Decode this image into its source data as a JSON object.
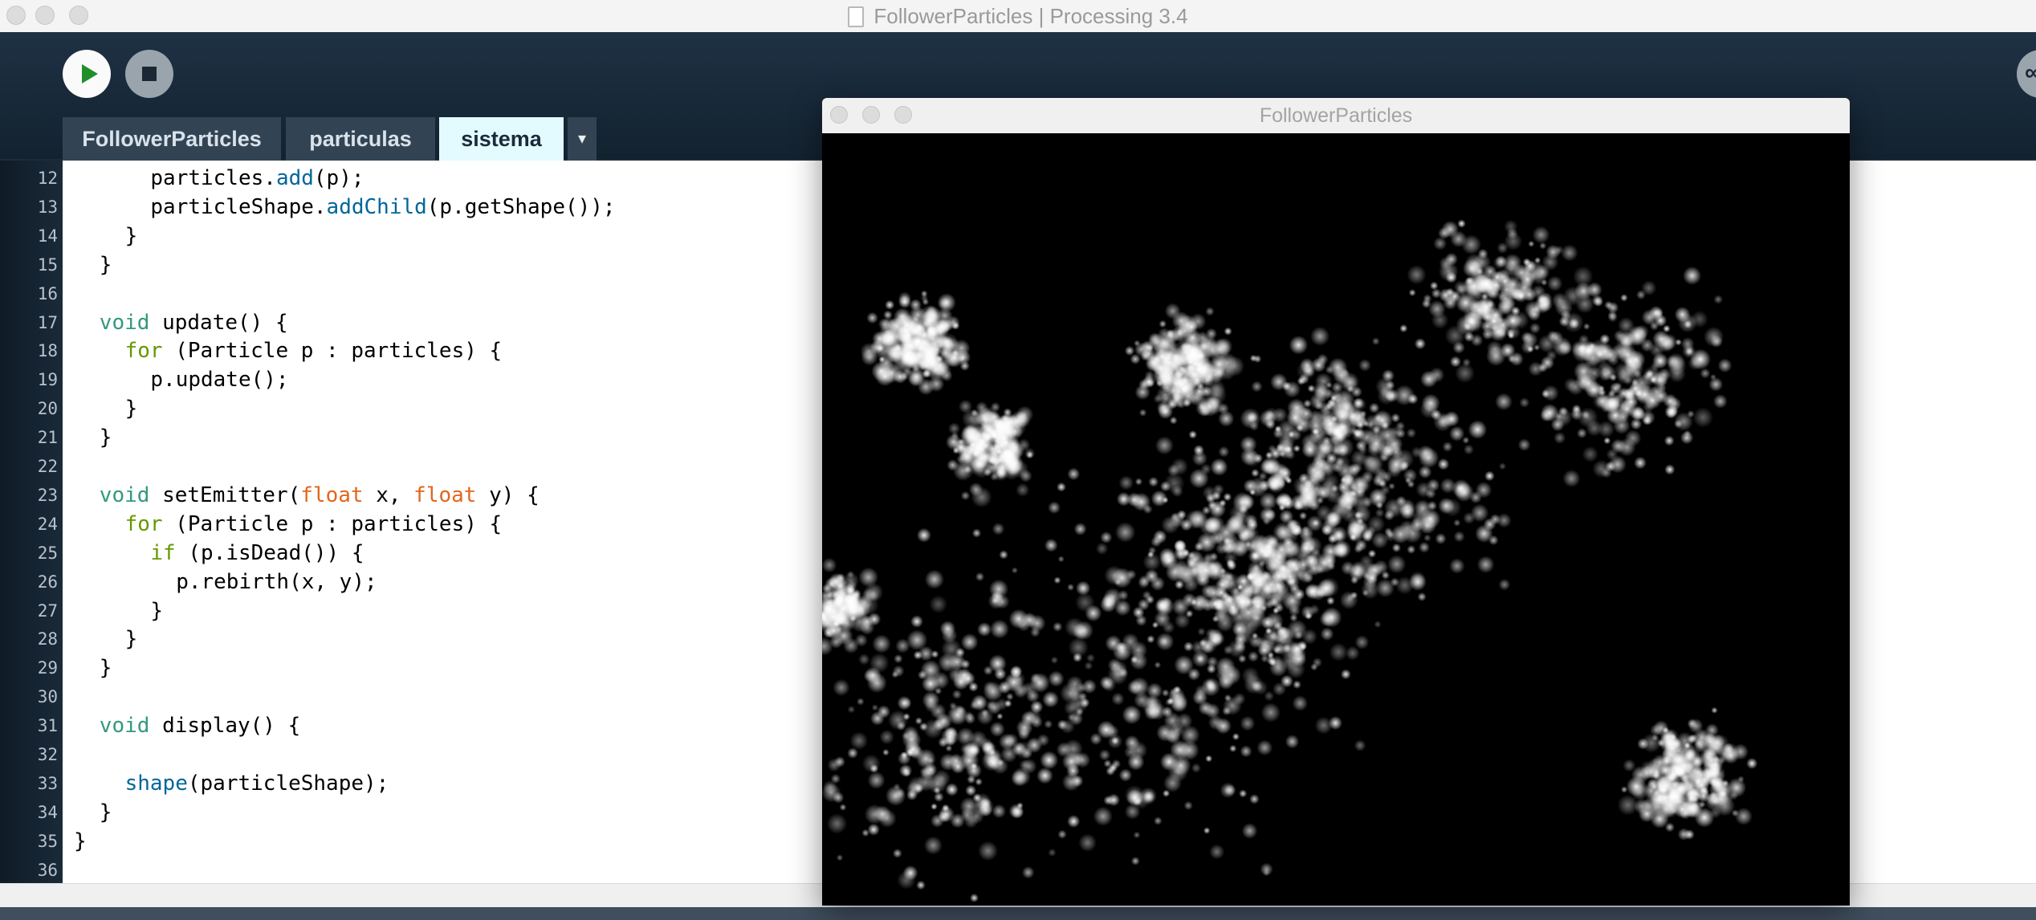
{
  "window": {
    "title": "FollowerParticles | Processing 3.4"
  },
  "toolbar": {
    "run_label": "Run",
    "stop_label": "Stop",
    "mode_label": "Mode"
  },
  "tabs": [
    {
      "label": "FollowerParticles",
      "active": false
    },
    {
      "label": "particulas",
      "active": false
    },
    {
      "label": "sistema",
      "active": true
    }
  ],
  "tab_menu_glyph": "▾",
  "editor": {
    "lines": [
      {
        "n": "12",
        "indent": 3,
        "tokens": [
          [
            "",
            "particles."
          ],
          [
            "fn",
            "add"
          ],
          [
            "",
            "(p);"
          ]
        ]
      },
      {
        "n": "13",
        "indent": 3,
        "tokens": [
          [
            "",
            "particleShape."
          ],
          [
            "fn",
            "addChild"
          ],
          [
            "",
            "(p.getShape());"
          ]
        ]
      },
      {
        "n": "14",
        "indent": 2,
        "tokens": [
          [
            "",
            "}"
          ]
        ]
      },
      {
        "n": "15",
        "indent": 1,
        "tokens": [
          [
            "",
            "}"
          ]
        ]
      },
      {
        "n": "16",
        "indent": 0,
        "tokens": []
      },
      {
        "n": "17",
        "indent": 1,
        "tokens": [
          [
            "kw",
            "void"
          ],
          [
            "",
            " update() {"
          ]
        ]
      },
      {
        "n": "18",
        "indent": 2,
        "tokens": [
          [
            "kw2",
            "for"
          ],
          [
            "",
            " (Particle p : particles) {"
          ]
        ]
      },
      {
        "n": "19",
        "indent": 3,
        "tokens": [
          [
            "",
            "p.update();"
          ]
        ]
      },
      {
        "n": "20",
        "indent": 2,
        "tokens": [
          [
            "",
            "}"
          ]
        ]
      },
      {
        "n": "21",
        "indent": 1,
        "tokens": [
          [
            "",
            "}"
          ]
        ]
      },
      {
        "n": "22",
        "indent": 0,
        "tokens": []
      },
      {
        "n": "23",
        "indent": 1,
        "tokens": [
          [
            "kw",
            "void"
          ],
          [
            "",
            " setEmitter("
          ],
          [
            "ty",
            "float"
          ],
          [
            "",
            " x, "
          ],
          [
            "ty",
            "float"
          ],
          [
            "",
            " y) {"
          ]
        ]
      },
      {
        "n": "24",
        "indent": 2,
        "tokens": [
          [
            "kw2",
            "for"
          ],
          [
            "",
            " (Particle p : particles) {"
          ]
        ]
      },
      {
        "n": "25",
        "indent": 3,
        "tokens": [
          [
            "kw2",
            "if"
          ],
          [
            "",
            " (p.isDead()) {"
          ]
        ]
      },
      {
        "n": "26",
        "indent": 4,
        "tokens": [
          [
            "",
            "p.rebirth(x, y);"
          ]
        ]
      },
      {
        "n": "27",
        "indent": 3,
        "tokens": [
          [
            "",
            "}"
          ]
        ]
      },
      {
        "n": "28",
        "indent": 2,
        "tokens": [
          [
            "",
            "}"
          ]
        ]
      },
      {
        "n": "29",
        "indent": 1,
        "tokens": [
          [
            "",
            "}"
          ]
        ]
      },
      {
        "n": "30",
        "indent": 0,
        "tokens": []
      },
      {
        "n": "31",
        "indent": 1,
        "tokens": [
          [
            "kw",
            "void"
          ],
          [
            "",
            " display() {"
          ]
        ]
      },
      {
        "n": "32",
        "indent": 0,
        "tokens": []
      },
      {
        "n": "33",
        "indent": 2,
        "tokens": [
          [
            "fn",
            "shape"
          ],
          [
            "",
            "(particleShape);"
          ]
        ]
      },
      {
        "n": "34",
        "indent": 1,
        "tokens": [
          [
            "",
            "}"
          ]
        ]
      },
      {
        "n": "35",
        "indent": 0,
        "tokens": [
          [
            "",
            "}"
          ]
        ]
      },
      {
        "n": "36",
        "indent": 0,
        "tokens": []
      }
    ]
  },
  "sketch_window": {
    "title": "FollowerParticles"
  }
}
